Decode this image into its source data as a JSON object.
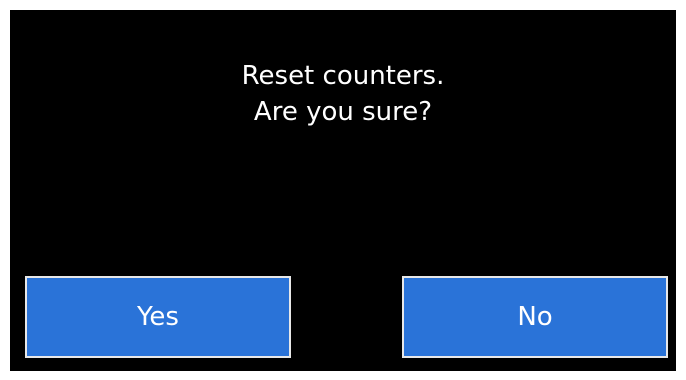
{
  "dialog": {
    "message_line1": "Reset counters.",
    "message_line2": "Are you sure?",
    "yes_label": "Yes",
    "no_label": "No"
  },
  "colors": {
    "screen_background": "#000000",
    "button_background": "#2a73d8",
    "button_border": "#e8e8e8",
    "text": "#ffffff"
  }
}
